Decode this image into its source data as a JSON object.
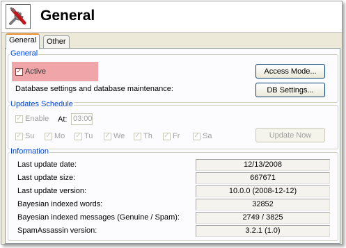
{
  "header": {
    "title": "General",
    "icon": "tools-icon"
  },
  "tabs": [
    {
      "label": "General",
      "active": true
    },
    {
      "label": "Other",
      "active": false
    }
  ],
  "general_group": {
    "legend": "General",
    "active_label": "Active",
    "active_checked": true,
    "highlight_color": "#f0a6a8",
    "access_mode_button": "Access Mode...",
    "db_description": "Database settings and database maintenance:",
    "db_settings_button": "DB Settings..."
  },
  "updates_group": {
    "legend": "Updates Schedule",
    "enable_label": "Enable",
    "at_label": "At:",
    "time_value": "03:00",
    "days": [
      "Su",
      "Mo",
      "Tu",
      "We",
      "Th",
      "Fr",
      "Sa"
    ],
    "update_now_button": "Update Now"
  },
  "info_group": {
    "legend": "Information",
    "rows": [
      {
        "label": "Last update date:",
        "value": "12/13/2008"
      },
      {
        "label": "Last update size:",
        "value": "667671"
      },
      {
        "label": "Last update version:",
        "value": "10.0.0 (2008-12-12)"
      },
      {
        "label": "Bayesian indexed words:",
        "value": "32852"
      },
      {
        "label": "Bayesian indexed messages (Genuine / Spam):",
        "value": "2749 / 3825"
      },
      {
        "label": "SpamAssassin version:",
        "value": "3.2.1 (1.0)"
      }
    ]
  },
  "colors": {
    "legend_text": "#0046d5",
    "tab_accent": "#e68b2c",
    "panel_bg": "#fcfcfe",
    "window_bg": "#ece9d8"
  }
}
